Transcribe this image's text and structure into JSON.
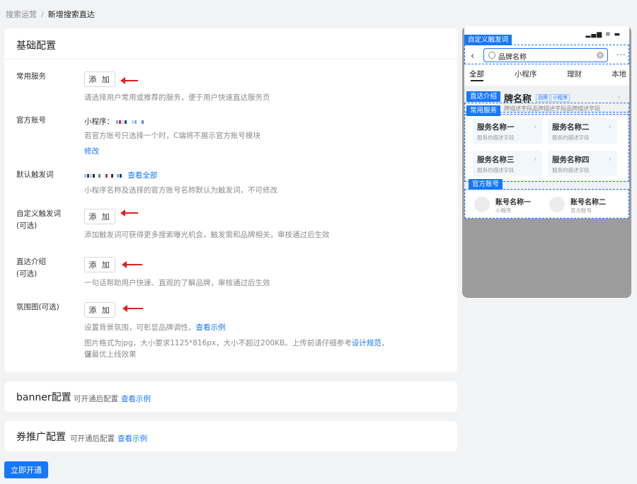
{
  "breadcrumb": {
    "parent": "搜索运营",
    "separator": "/",
    "current": "新增搜索直达"
  },
  "basic": {
    "title": "基础配置",
    "common_service": {
      "label": "常用服务",
      "button": "添 加",
      "hint": "请选择用户常用或推荐的服务，便于用户快速直达服务页"
    },
    "official_account": {
      "label": "官方账号",
      "prefix": "小程序：",
      "hint": "若官方账号只选择一个时，C端将不展示官方账号模块",
      "edit": "修改"
    },
    "default_trigger": {
      "label": "默认触发词",
      "view_all": "查看全部",
      "hint": "小程序名称及选择的官方账号名称默认为触发词，不可修改"
    },
    "custom_trigger": {
      "label": "自定义触发词",
      "optional": "(可选)",
      "button": "添 加",
      "hint": "添加触发词可获得更多搜索曝光机会，触发需和品牌相关，审核通过后生效"
    },
    "intro": {
      "label": "直达介绍",
      "optional": "(可选)",
      "button": "添 加",
      "hint": "一句话帮助用户快速、直观的了解品牌，审核通过后生效"
    },
    "atmosphere": {
      "label": "氛围图(可选)",
      "button": "添 加",
      "hint": "设置背景氛围，可彰显品牌调性。",
      "example": "查看示例",
      "spec": "图片格式为jpg，大小要求1125*816px，大小不超过200KB。上传前请仔细参考",
      "spec_link": "设计规范",
      "spec_tail": "，保",
      "spec_line2": "证最优上线效果"
    }
  },
  "banner": {
    "title": "banner配置",
    "sub": "可开通后配置",
    "link": "查看示例"
  },
  "coupon": {
    "title": "券推广配置",
    "sub": "可开通后配置",
    "link": "查看示例"
  },
  "submit": "立即开通",
  "preview": {
    "status": "▂▄▆ ≋ ▬",
    "custom_trigger_tag": "自定义触发词",
    "search_value": "品牌名称",
    "more": "···",
    "tabs": [
      "全部",
      "小程序",
      "理财",
      "本地"
    ],
    "intro_tag": "直达介绍",
    "brand_name": "牌名称",
    "brand_tags": [
      "品牌",
      "小程序"
    ],
    "brand_desc": "牌描述字段品牌描述字段品牌描述字段",
    "service_tag": "常用服务",
    "services": [
      {
        "name": "服务名称一",
        "desc": "服务的描述字段"
      },
      {
        "name": "服务名称二",
        "desc": "服务的描述字段"
      },
      {
        "name": "服务名称三",
        "desc": "服务的描述字段"
      },
      {
        "name": "服务名称四",
        "desc": "服务的描述字段"
      }
    ],
    "account_tag": "官方账号",
    "accounts": [
      {
        "name": "账号名称一",
        "desc": "小程序"
      },
      {
        "name": "账号名称二",
        "desc": "官方账号"
      }
    ]
  },
  "colors": {
    "primary": "#1677ff",
    "arrow": "#e02020"
  }
}
